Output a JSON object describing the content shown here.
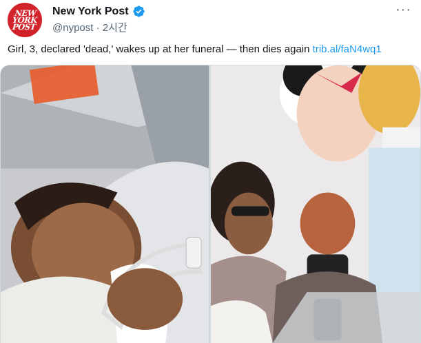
{
  "tweet": {
    "author_name": "New York Post",
    "handle": "@nypost",
    "separator": "·",
    "time": "2시간",
    "verified": true,
    "avatar_lines": [
      "NEW",
      "YORK",
      "POST"
    ],
    "text": "Girl, 3, declared 'dead,' wakes up at her funeral — then dies again",
    "link": "trib.al/faN4wq1",
    "more_label": "···"
  },
  "colors": {
    "link": "#1d9bf0",
    "verified_badge": "#1d9bf0",
    "avatar_bg": "#d2232a",
    "secondary_text": "#536471"
  },
  "media": {
    "count": 2,
    "items": [
      "hospital-photo",
      "funeral-photo"
    ]
  }
}
